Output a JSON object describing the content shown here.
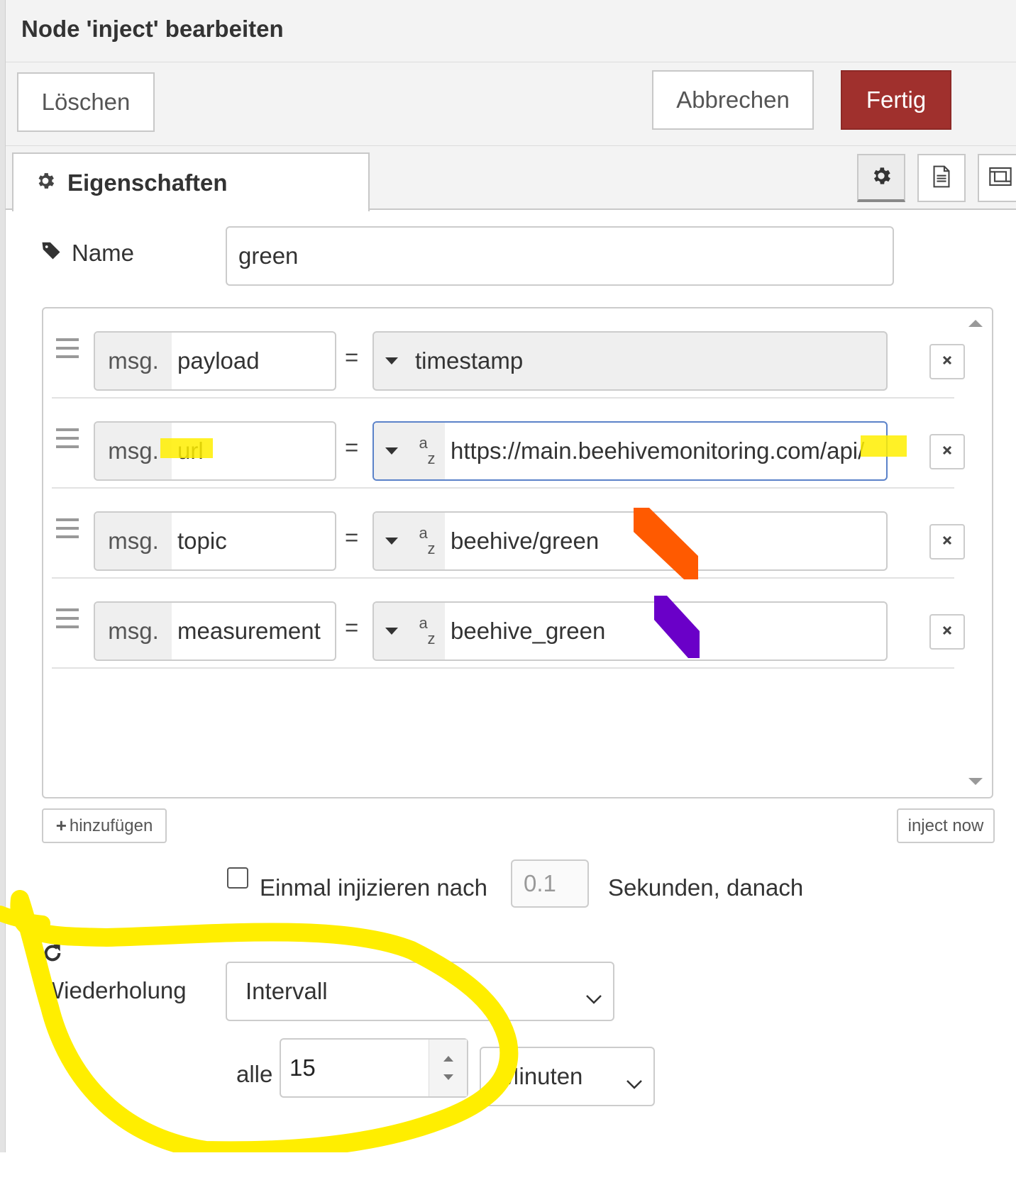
{
  "dialog": {
    "title": "Node 'inject' bearbeiten",
    "delete_label": "Löschen",
    "cancel_label": "Abbrechen",
    "done_label": "Fertig",
    "accent_color": "#a0302d"
  },
  "tabs": {
    "properties_label": "Eigenschaften",
    "icons": [
      "gear-icon",
      "description-icon",
      "appearance-icon"
    ]
  },
  "form": {
    "name_label": "Name",
    "name_value": "green",
    "properties": [
      {
        "prefix": "msg.",
        "property": "payload",
        "equals": "=",
        "type": "timestamp",
        "value": "timestamp"
      },
      {
        "prefix": "msg.",
        "property": "url",
        "equals": "=",
        "type": "string",
        "type_glyph_top": "a",
        "type_glyph_bottom": "z",
        "value": "https://main.beehivemonitoring.com/api/"
      },
      {
        "prefix": "msg.",
        "property": "topic",
        "equals": "=",
        "type": "string",
        "type_glyph_top": "a",
        "type_glyph_bottom": "z",
        "value": "beehive/green"
      },
      {
        "prefix": "msg.",
        "property": "measurement",
        "equals": "=",
        "type": "string",
        "type_glyph_top": "a",
        "type_glyph_bottom": "z",
        "value": "beehive_green"
      }
    ],
    "add_label": "hinzufügen",
    "inject_now_label": "inject now",
    "once_label": "Einmal injizieren nach",
    "once_value": "0.1",
    "once_suffix": "Sekunden, danach",
    "repeat_label": "Wiederholung",
    "repeat_mode": "Intervall",
    "every_label": "alle",
    "every_value": "15",
    "every_unit": "Minuten"
  },
  "annotations": {
    "highlight_color": "#ffee00",
    "orange_mark_color": "#ff5a00",
    "purple_mark_color": "#6a00c8"
  }
}
